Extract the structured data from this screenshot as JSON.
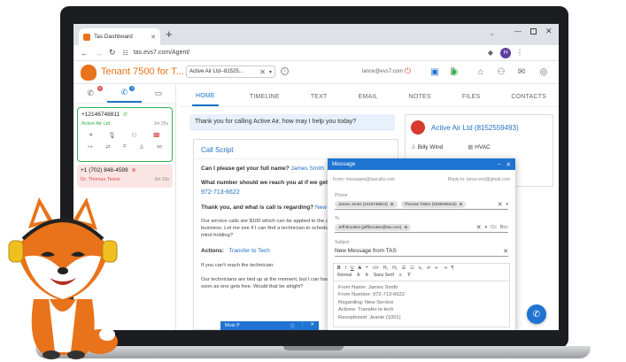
{
  "browser": {
    "tab_title": "Tas Dashboard",
    "new_tab": "+",
    "url": "tas.evs7.com/Agent/",
    "profile_initial": "H"
  },
  "header": {
    "tenant": "Tenant 7500 for T...",
    "client_select": "Active Air Ltd--81525...",
    "user_email": "lance@evs7.com"
  },
  "left_panel": {
    "tabs": [
      {
        "name": "inbox",
        "badge": "1"
      },
      {
        "name": "calls",
        "badge": "3"
      },
      {
        "name": "chat",
        "badge": ""
      }
    ],
    "calls": [
      {
        "number": "+12146748811",
        "company": "Active Air Ltd",
        "duration": "1m 25s",
        "active": true
      },
      {
        "number": "+1 (702) 848-4599",
        "company": "Dr. Thomas Tinker",
        "duration": "2m 33s",
        "active": false
      }
    ]
  },
  "main": {
    "tabs": [
      "HOME",
      "TIMELINE",
      "TEXT",
      "EMAIL",
      "NOTES",
      "FILES",
      "CONTACTS"
    ],
    "greeting": "Thank you for calling Active Air, how may I help you today?",
    "script_title": "Call Script",
    "q1": "Can I please get your full name?",
    "q1_answer": "James Smith",
    "q2": "What number should we reach you at if we get disconnected?",
    "q2_answer": "972-713-6622",
    "q3": "Thank you, and what is call is regarding?",
    "q3_answer": "New Service",
    "service_text": "Our service calls are $100 which can be applied to the cost of repair for your business. Let me see if I can find a technician to schedule an appointment. Do you mind holding?",
    "actions_label": "Actions:",
    "actions_value": "Transfer to Tech",
    "cant_reach": "If you can't reach the technician:",
    "tied_up": "Our technicians are tied up at the moment, but I can have one call you back just as soon as one gets free. Would that be alright?",
    "company_name": "Active Air Ltd (8152559493)",
    "contact_person": "Billy Wind",
    "industry": "HVAC"
  },
  "message": {
    "title": "Message",
    "from_label": "From:",
    "from_value": "messages@tascalls.com",
    "reply_label": "Reply-to:",
    "reply_value": "lance.evs@gmail.com",
    "phone_label": "Phone",
    "phone_chips": [
      "James Jones (2416748814)",
      "Thomas Tinker (2038269415)"
    ],
    "to_label": "To",
    "to_chips": [
      "Jeff Brookes (jeffbrookes@tas.com)"
    ],
    "cc": "Cc",
    "bcc": "Bcc",
    "subject_label": "Subject",
    "subject_value": "New Message from TAS",
    "toolbar_style": "Normal",
    "toolbar_font": "Sans Serif",
    "body_lines": [
      "From Name: James Smith",
      "From Number: 972-713-6622",
      "Regarding: New Service",
      "Actions: Transfer to tech",
      "Receptionist: Jeanie (1001)"
    ]
  },
  "dock": {
    "name": "Moiz P"
  },
  "colors": {
    "accent": "#1f73d1",
    "active_call_green": "#2fb14a",
    "missed_call_red": "#d9534f",
    "tenant_orange": "#e8731a"
  }
}
